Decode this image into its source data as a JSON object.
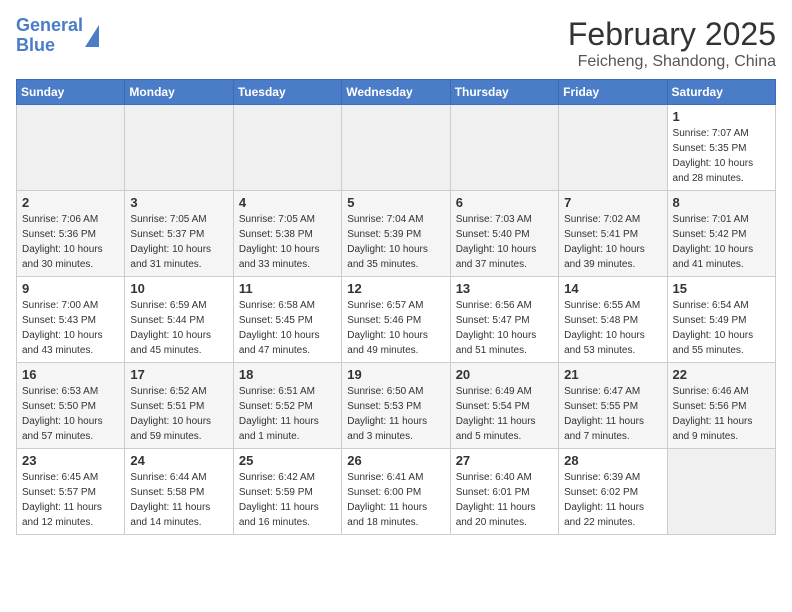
{
  "header": {
    "logo_line1": "General",
    "logo_line2": "Blue",
    "title": "February 2025",
    "subtitle": "Feicheng, Shandong, China"
  },
  "weekdays": [
    "Sunday",
    "Monday",
    "Tuesday",
    "Wednesday",
    "Thursday",
    "Friday",
    "Saturday"
  ],
  "weeks": [
    [
      {
        "day": "",
        "info": ""
      },
      {
        "day": "",
        "info": ""
      },
      {
        "day": "",
        "info": ""
      },
      {
        "day": "",
        "info": ""
      },
      {
        "day": "",
        "info": ""
      },
      {
        "day": "",
        "info": ""
      },
      {
        "day": "1",
        "info": "Sunrise: 7:07 AM\nSunset: 5:35 PM\nDaylight: 10 hours and 28 minutes."
      }
    ],
    [
      {
        "day": "2",
        "info": "Sunrise: 7:06 AM\nSunset: 5:36 PM\nDaylight: 10 hours and 30 minutes."
      },
      {
        "day": "3",
        "info": "Sunrise: 7:05 AM\nSunset: 5:37 PM\nDaylight: 10 hours and 31 minutes."
      },
      {
        "day": "4",
        "info": "Sunrise: 7:05 AM\nSunset: 5:38 PM\nDaylight: 10 hours and 33 minutes."
      },
      {
        "day": "5",
        "info": "Sunrise: 7:04 AM\nSunset: 5:39 PM\nDaylight: 10 hours and 35 minutes."
      },
      {
        "day": "6",
        "info": "Sunrise: 7:03 AM\nSunset: 5:40 PM\nDaylight: 10 hours and 37 minutes."
      },
      {
        "day": "7",
        "info": "Sunrise: 7:02 AM\nSunset: 5:41 PM\nDaylight: 10 hours and 39 minutes."
      },
      {
        "day": "8",
        "info": "Sunrise: 7:01 AM\nSunset: 5:42 PM\nDaylight: 10 hours and 41 minutes."
      }
    ],
    [
      {
        "day": "9",
        "info": "Sunrise: 7:00 AM\nSunset: 5:43 PM\nDaylight: 10 hours and 43 minutes."
      },
      {
        "day": "10",
        "info": "Sunrise: 6:59 AM\nSunset: 5:44 PM\nDaylight: 10 hours and 45 minutes."
      },
      {
        "day": "11",
        "info": "Sunrise: 6:58 AM\nSunset: 5:45 PM\nDaylight: 10 hours and 47 minutes."
      },
      {
        "day": "12",
        "info": "Sunrise: 6:57 AM\nSunset: 5:46 PM\nDaylight: 10 hours and 49 minutes."
      },
      {
        "day": "13",
        "info": "Sunrise: 6:56 AM\nSunset: 5:47 PM\nDaylight: 10 hours and 51 minutes."
      },
      {
        "day": "14",
        "info": "Sunrise: 6:55 AM\nSunset: 5:48 PM\nDaylight: 10 hours and 53 minutes."
      },
      {
        "day": "15",
        "info": "Sunrise: 6:54 AM\nSunset: 5:49 PM\nDaylight: 10 hours and 55 minutes."
      }
    ],
    [
      {
        "day": "16",
        "info": "Sunrise: 6:53 AM\nSunset: 5:50 PM\nDaylight: 10 hours and 57 minutes."
      },
      {
        "day": "17",
        "info": "Sunrise: 6:52 AM\nSunset: 5:51 PM\nDaylight: 10 hours and 59 minutes."
      },
      {
        "day": "18",
        "info": "Sunrise: 6:51 AM\nSunset: 5:52 PM\nDaylight: 11 hours and 1 minute."
      },
      {
        "day": "19",
        "info": "Sunrise: 6:50 AM\nSunset: 5:53 PM\nDaylight: 11 hours and 3 minutes."
      },
      {
        "day": "20",
        "info": "Sunrise: 6:49 AM\nSunset: 5:54 PM\nDaylight: 11 hours and 5 minutes."
      },
      {
        "day": "21",
        "info": "Sunrise: 6:47 AM\nSunset: 5:55 PM\nDaylight: 11 hours and 7 minutes."
      },
      {
        "day": "22",
        "info": "Sunrise: 6:46 AM\nSunset: 5:56 PM\nDaylight: 11 hours and 9 minutes."
      }
    ],
    [
      {
        "day": "23",
        "info": "Sunrise: 6:45 AM\nSunset: 5:57 PM\nDaylight: 11 hours and 12 minutes."
      },
      {
        "day": "24",
        "info": "Sunrise: 6:44 AM\nSunset: 5:58 PM\nDaylight: 11 hours and 14 minutes."
      },
      {
        "day": "25",
        "info": "Sunrise: 6:42 AM\nSunset: 5:59 PM\nDaylight: 11 hours and 16 minutes."
      },
      {
        "day": "26",
        "info": "Sunrise: 6:41 AM\nSunset: 6:00 PM\nDaylight: 11 hours and 18 minutes."
      },
      {
        "day": "27",
        "info": "Sunrise: 6:40 AM\nSunset: 6:01 PM\nDaylight: 11 hours and 20 minutes."
      },
      {
        "day": "28",
        "info": "Sunrise: 6:39 AM\nSunset: 6:02 PM\nDaylight: 11 hours and 22 minutes."
      },
      {
        "day": "",
        "info": ""
      }
    ]
  ]
}
